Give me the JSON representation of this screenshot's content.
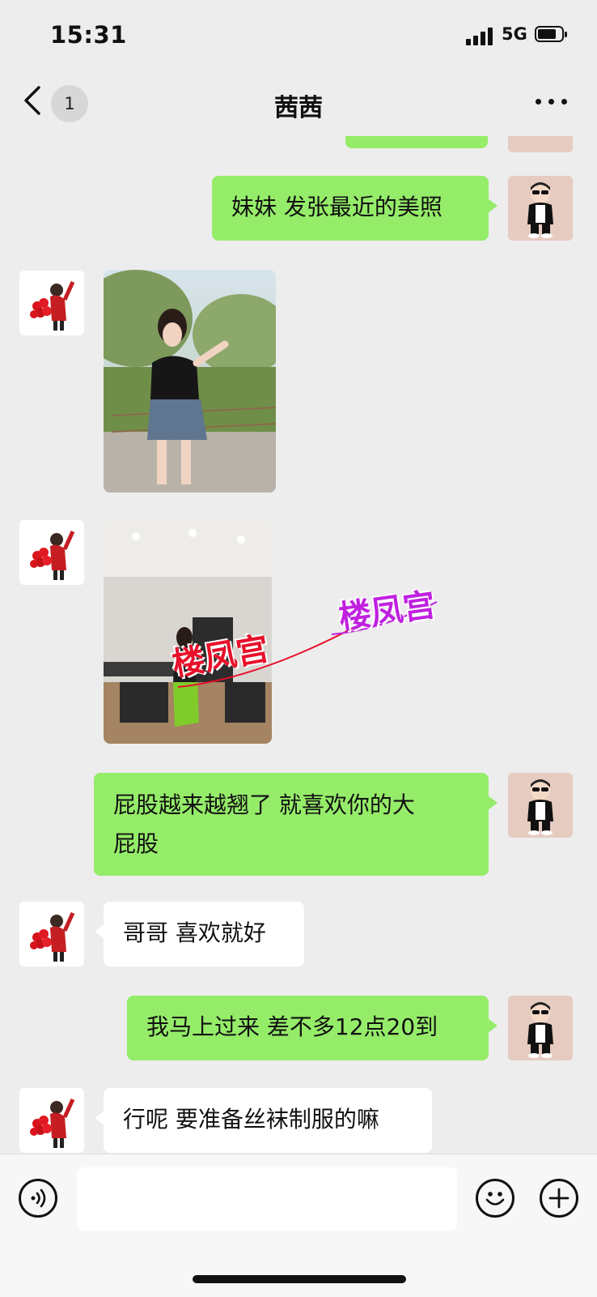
{
  "status_bar": {
    "time": "15:31",
    "network": "5G"
  },
  "nav": {
    "unread_count": "1",
    "title": "茜茜"
  },
  "messages": [
    {
      "from": "me",
      "text": "妹妹 发张最近的美照"
    },
    {
      "from": "her",
      "type": "photo",
      "description": "photo-park"
    },
    {
      "from": "her",
      "type": "photo",
      "description": "photo-gym",
      "watermark": "楼凤宫"
    },
    {
      "from": "me",
      "text_line1": "屁股越来越翘了 就喜欢你的大",
      "text_line2": "屁股"
    },
    {
      "from": "her",
      "text": "哥哥 喜欢就好"
    },
    {
      "from": "me",
      "text": "我马上过来 差不多12点20到"
    },
    {
      "from": "her",
      "text": "行呢 要准备丝袜制服的嘛"
    }
  ],
  "input_bar": {
    "placeholder": "",
    "left_icon": "voice-icon",
    "right_icons": [
      "emoji-icon",
      "plus-icon"
    ]
  },
  "colors": {
    "background": "#ededed",
    "my_bubble": "#95ec69",
    "her_bubble": "#ffffff",
    "watermark_red": "#e8102a",
    "watermark_purple": "#c020e0"
  }
}
